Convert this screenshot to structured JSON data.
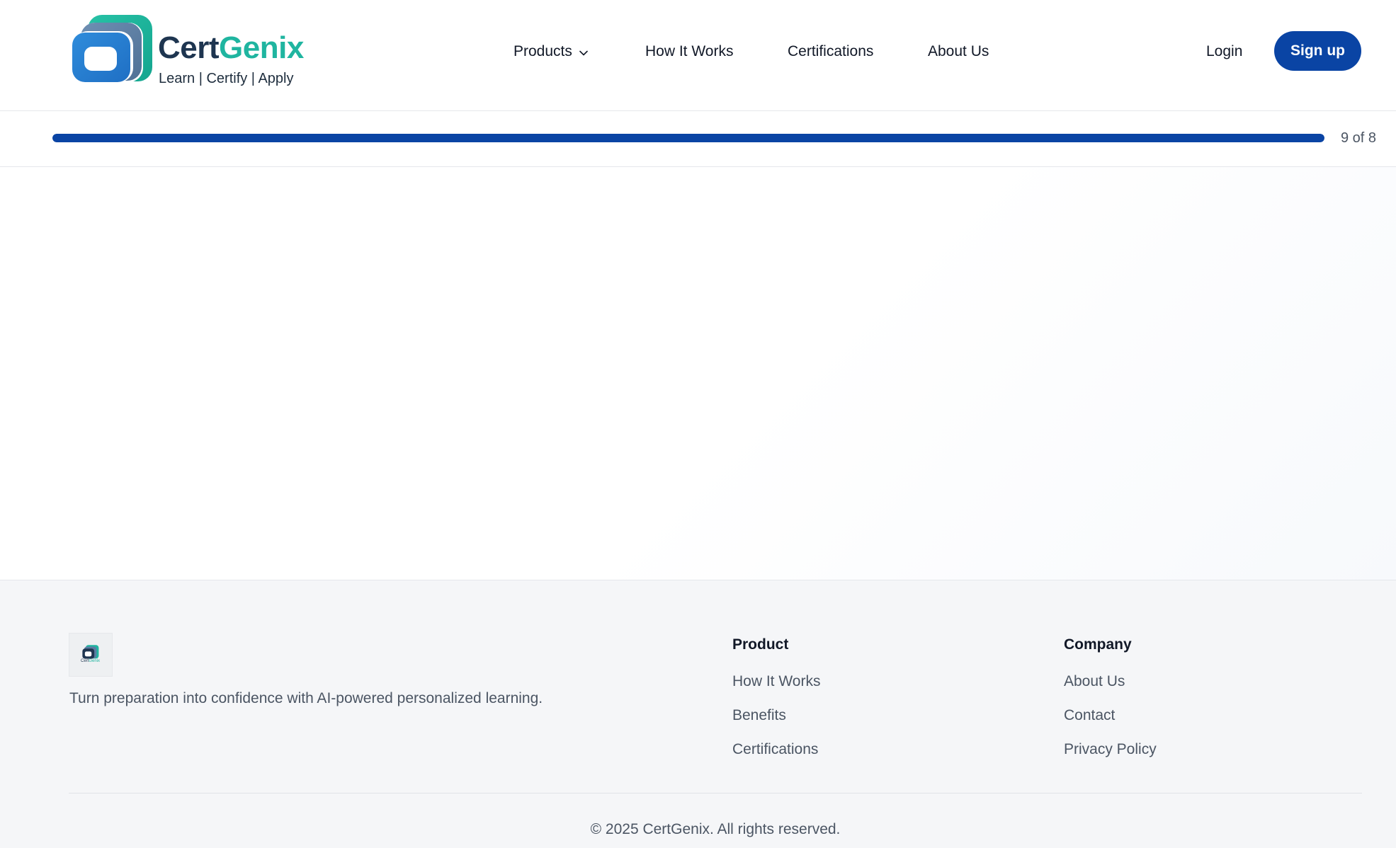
{
  "brand": {
    "name_part1": "Cert",
    "name_part2": "Genix",
    "tagline": "Learn | Certify | Apply",
    "colors": {
      "navy": "#1e3550",
      "teal": "#1fb5a0",
      "blue": "#0a44a4"
    }
  },
  "nav": {
    "items": [
      {
        "label": "Products",
        "has_dropdown": true,
        "icon": "chevron-down-icon"
      },
      {
        "label": "How It Works"
      },
      {
        "label": "Certifications"
      },
      {
        "label": "About Us"
      }
    ],
    "login_label": "Login",
    "signup_label": "Sign up"
  },
  "progress": {
    "text": "9 of 8",
    "fraction": 1.0
  },
  "footer": {
    "description": "Turn preparation into confidence with AI-powered personalized learning.",
    "columns": [
      {
        "title": "Product",
        "links": [
          "How It Works",
          "Benefits",
          "Certifications"
        ]
      },
      {
        "title": "Company",
        "links": [
          "About Us",
          "Contact",
          "Privacy Policy"
        ]
      }
    ],
    "copyright": "© 2025 CertGenix. All rights reserved."
  }
}
